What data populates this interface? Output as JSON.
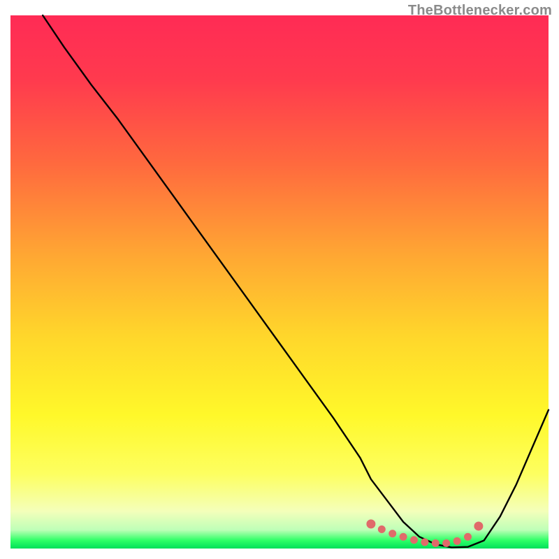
{
  "attribution": "TheBottlenecker.com",
  "chart_data": {
    "type": "line",
    "title": "",
    "xlabel": "",
    "ylabel": "",
    "xlim": [
      0,
      100
    ],
    "ylim": [
      0,
      100
    ],
    "background_gradient_stops": [
      {
        "offset": 0,
        "color": "#ff2b55"
      },
      {
        "offset": 0.12,
        "color": "#ff3a4e"
      },
      {
        "offset": 0.28,
        "color": "#ff6a3e"
      },
      {
        "offset": 0.45,
        "color": "#ffa733"
      },
      {
        "offset": 0.6,
        "color": "#ffd62b"
      },
      {
        "offset": 0.75,
        "color": "#fff82a"
      },
      {
        "offset": 0.86,
        "color": "#fdff60"
      },
      {
        "offset": 0.93,
        "color": "#f4ffba"
      },
      {
        "offset": 0.965,
        "color": "#bfffb8"
      },
      {
        "offset": 0.985,
        "color": "#2dff66"
      },
      {
        "offset": 1.0,
        "color": "#00e05a"
      }
    ],
    "series": [
      {
        "name": "bottleneck-curve",
        "x": [
          6,
          10,
          15,
          20,
          25,
          30,
          35,
          40,
          45,
          50,
          55,
          60,
          65,
          67,
          70,
          73,
          76,
          79,
          82,
          85,
          88,
          91,
          94,
          97,
          100
        ],
        "y": [
          100,
          94,
          87,
          80.5,
          73.5,
          66.5,
          59.5,
          52.5,
          45.5,
          38.5,
          31.5,
          24.5,
          17,
          13,
          9,
          5,
          2.2,
          0.8,
          0.2,
          0.3,
          1.5,
          6,
          12,
          19,
          26
        ]
      }
    ],
    "marker_points": {
      "name": "curve-dots",
      "x": [
        67,
        69,
        71,
        73,
        75,
        77,
        79,
        81,
        83,
        85,
        87
      ],
      "y": [
        4.6,
        3.6,
        2.8,
        2.2,
        1.6,
        1.2,
        1.0,
        1.0,
        1.4,
        2.2,
        4.2
      ]
    },
    "colors": {
      "curve": "#000000",
      "marker_fill": "#e06a6a",
      "marker_stroke": "#e06a6a"
    }
  }
}
